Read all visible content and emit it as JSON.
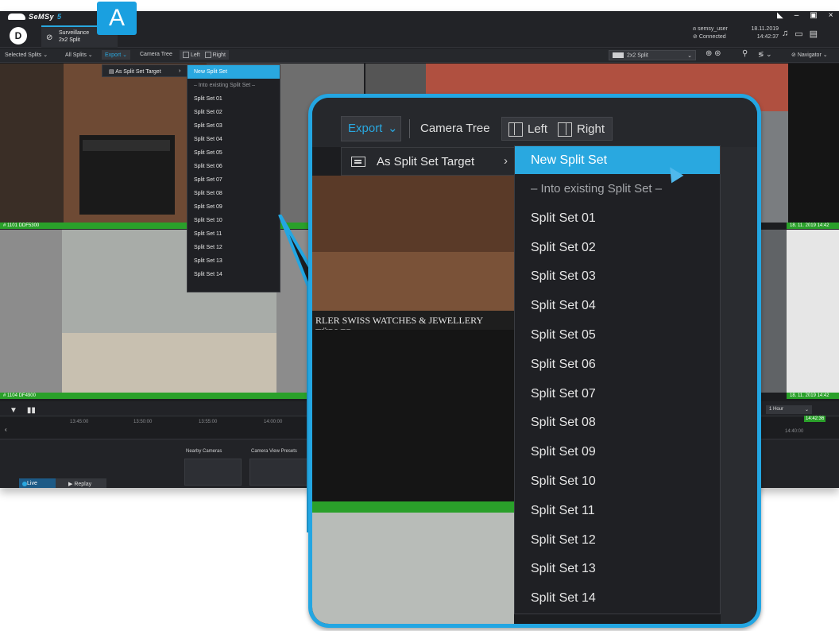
{
  "brand": {
    "name": "SeMSy",
    "suffix": "5"
  },
  "callout_label": "A",
  "tab": {
    "line1": "Surveillance",
    "line2": "2x2 Split"
  },
  "user": {
    "name": "semsy_user",
    "status": "Connected"
  },
  "datetime": {
    "date": "18.11.2019",
    "time": "14:42:37"
  },
  "toolbar": {
    "selected_splits": "Selected Splits",
    "all_splits": "All Splits",
    "export": "Export",
    "camera_tree": "Camera Tree",
    "left": "Left",
    "right": "Right",
    "split_select": "2x2 Split",
    "navigator": "Navigator"
  },
  "export_menu": {
    "target_item": "As Split Set Target",
    "items": [
      "New Split Set",
      "– Into existing Split Set –",
      "Split Set 01",
      "Split Set 02",
      "Split Set 03",
      "Split Set 04",
      "Split Set 05",
      "Split Set 06",
      "Split Set 07",
      "Split Set 08",
      "Split Set 09",
      "Split Set 10",
      "Split Set 11",
      "Split Set 12",
      "Split Set 13",
      "Split Set 14"
    ]
  },
  "cameras": {
    "cam1": "# 1101  DDF5300",
    "cam2": "# 1104  DF4900",
    "stamp1": "18. 11. 2019  14:42",
    "stamp2": "18. 11. 2019  14:42"
  },
  "timeline": {
    "ticks": [
      "13:45:00",
      "13:50:00",
      "13:55:00",
      "14:00:00"
    ],
    "tick_right": "14:40:00",
    "now": "14:42:36",
    "range": "1 Hour",
    "nearby_cameras": "Nearby Cameras",
    "camera_view_presets": "Camera View Presets",
    "live": "Live",
    "replay": "Replay"
  },
  "colors": {
    "accent": "#29a8e0",
    "highlight": "#23a6e2",
    "status_green": "#2aa02a",
    "bg_dark": "#1c1d20"
  }
}
